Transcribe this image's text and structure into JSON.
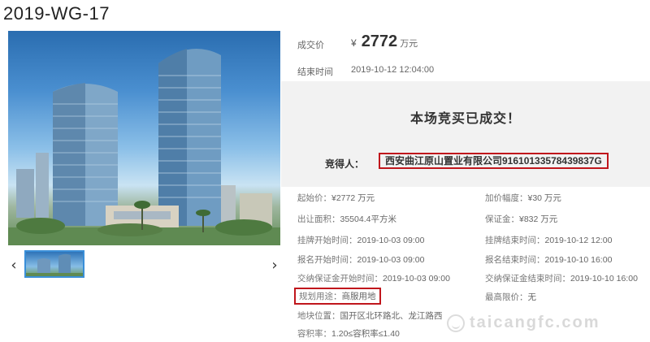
{
  "page_title": "2019-WG-17",
  "nav": {
    "prev": "‹",
    "next": "›"
  },
  "deal": {
    "price_label": "成交价",
    "price_currency": "¥",
    "price_value": "2772",
    "price_unit": "万元",
    "end_time_label": "结束时间",
    "end_time_value": "2019-10-12 12:04:00"
  },
  "result": {
    "title": "本场竞买已成交！",
    "winner_label": "竞得人：",
    "winner_value": "西安曲江原山置业有限公司91610133578439837G"
  },
  "details_left": [
    {
      "label": "起始价：",
      "value": "¥2772 万元"
    },
    {
      "label": "出让面积：",
      "value": "35504.4平方米"
    },
    {
      "label": "挂牌开始时间：",
      "value": "2019-10-03 09:00"
    },
    {
      "label": "报名开始时间：",
      "value": "2019-10-03 09:00"
    },
    {
      "label": "交纳保证金开始时间：",
      "value": "2019-10-03 09:00"
    },
    {
      "label": "规划用途：",
      "value": "商服用地"
    },
    {
      "label": "地块位置：",
      "value": "国开区北环路北、龙江路西"
    },
    {
      "label": "容积率：",
      "value": "1.20≤容积率≤1.40"
    }
  ],
  "details_right": [
    {
      "label": "加价幅度：",
      "value": "¥30 万元"
    },
    {
      "label": "保证金：",
      "value": "¥832 万元"
    },
    {
      "label": "挂牌结束时间：",
      "value": "2019-10-12 12:00"
    },
    {
      "label": "报名结束时间：",
      "value": "2019-10-10 16:00"
    },
    {
      "label": "交纳保证金结束时间：",
      "value": "2019-10-10 16:00"
    },
    {
      "label": "最高限价：",
      "value": "无"
    }
  ],
  "watermark": "taicangfc.com",
  "colors": {
    "highlight_border": "#c0161c",
    "panel_bg": "#f2f2f2",
    "thumb_border": "#3a8fd8"
  }
}
